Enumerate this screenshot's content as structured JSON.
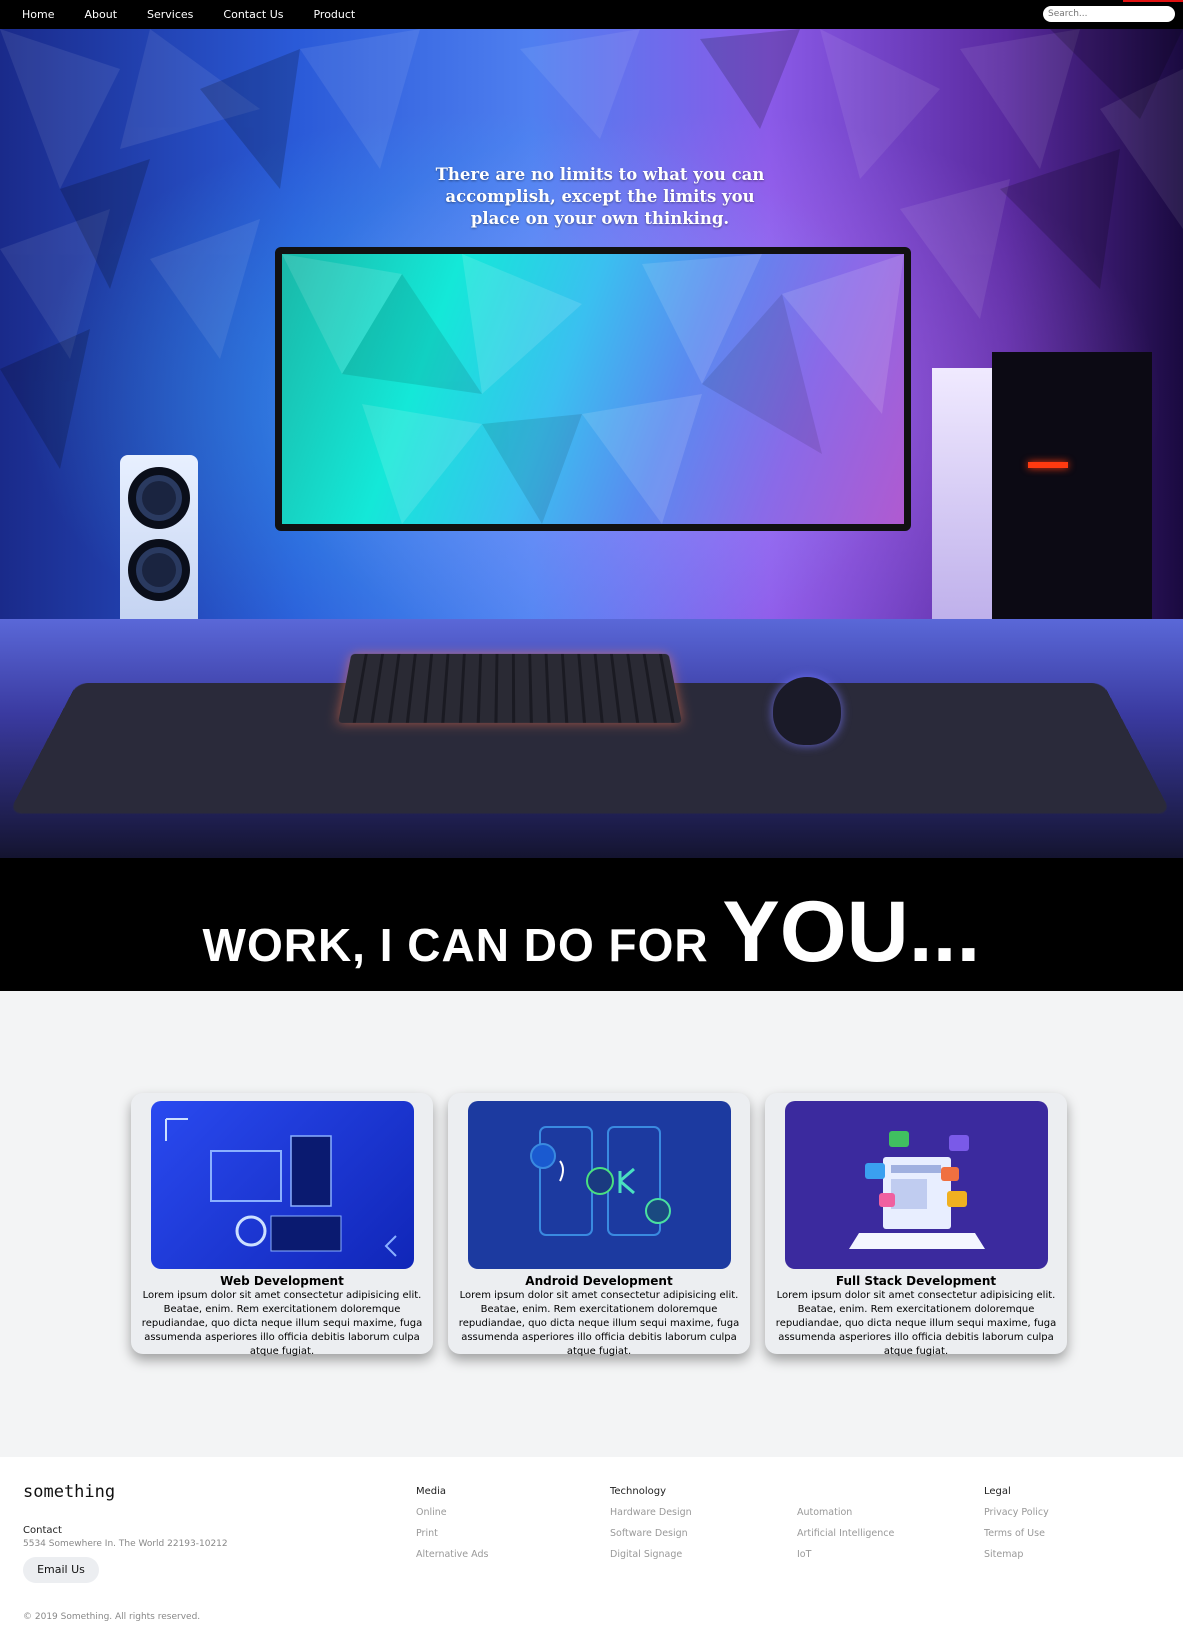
{
  "nav": {
    "links": [
      "Home",
      "About",
      "Services",
      "Contact Us",
      "Product"
    ],
    "search_placeholder": "Search..."
  },
  "hero": {
    "quote": "There are no limits to what you can accomplish, except the limits you place on your own thinking."
  },
  "banner": {
    "small": "WORK, I CAN DO FOR ",
    "big": "YOU..."
  },
  "services": [
    {
      "title": "Web Development",
      "body": "Lorem ipsum dolor sit amet consectetur adipisicing elit. Beatae, enim. Rem exercitationem doloremque repudiandae, quo dicta neque illum sequi maxime, fuga assumenda asperiores illo officia debitis laborum culpa atque fugiat.",
      "color": "#1f3fe8"
    },
    {
      "title": "Android Development",
      "body": "Lorem ipsum dolor sit amet consectetur adipisicing elit. Beatae, enim. Rem exercitationem doloremque repudiandae, quo dicta neque illum sequi maxime, fuga assumenda asperiores illo officia debitis laborum culpa atque fugiat.",
      "color": "#1a3a9c"
    },
    {
      "title": "Full Stack Development",
      "body": "Lorem ipsum dolor sit amet consectetur adipisicing elit. Beatae, enim. Rem exercitationem doloremque repudiandae, quo dicta neque illum sequi maxime, fuga assumenda asperiores illo officia debitis laborum culpa atque fugiat.",
      "color": "#3a2a9c"
    }
  ],
  "footer": {
    "brand": "something",
    "contact_label": "Contact",
    "address": "5534 Somewhere In. The World 22193-10212",
    "email_button": "Email Us",
    "columns": [
      {
        "title": "Media",
        "items": [
          "Online",
          "Print",
          "Alternative Ads"
        ]
      },
      {
        "title": "Technology",
        "items": [
          "Hardware Design",
          "Software Design",
          "Digital Signage"
        ]
      },
      {
        "title": "",
        "items": [
          "Automation",
          "Artificial Intelligence",
          "IoT"
        ]
      },
      {
        "title": "Legal",
        "items": [
          "Privacy Policy",
          "Terms of Use",
          "Sitemap"
        ]
      }
    ],
    "copyright": "© 2019 Something. All rights reserved."
  },
  "colors": {
    "nav_bg": "#000000",
    "accent": "#e01010",
    "services_bg": "#f3f4f5",
    "card_bg": "#eceef1"
  }
}
